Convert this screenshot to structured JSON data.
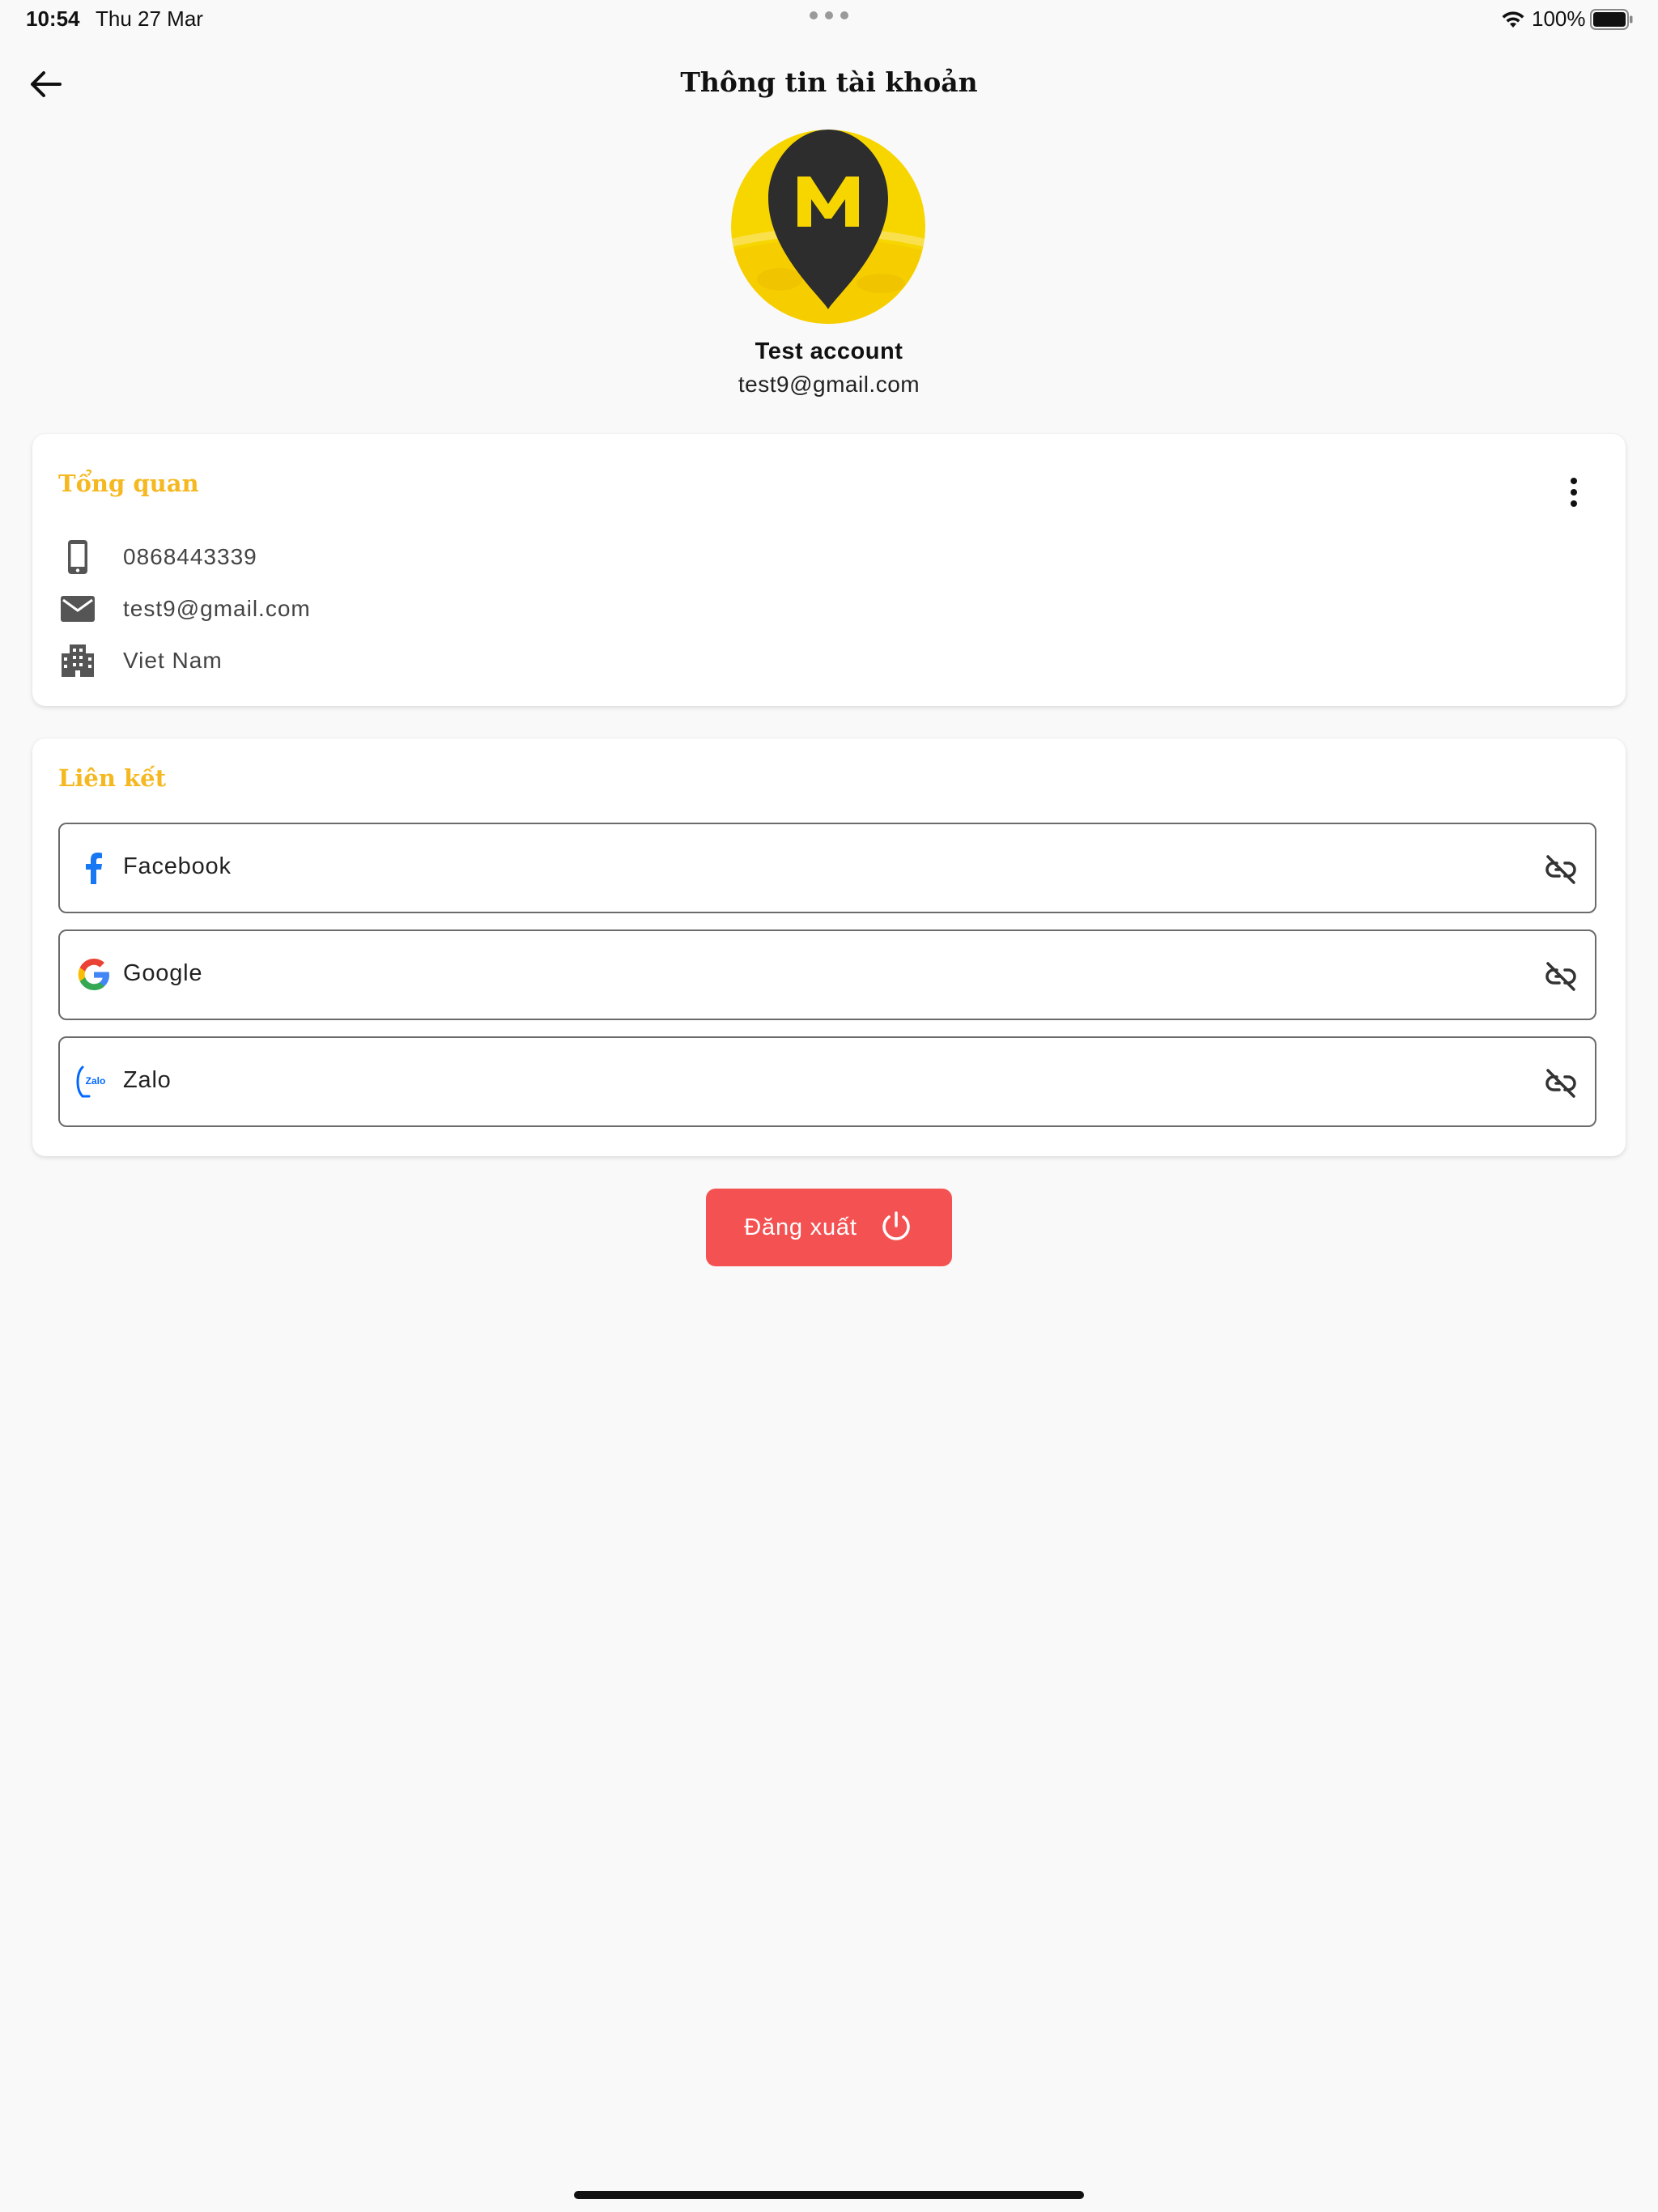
{
  "status_bar": {
    "time": "10:54",
    "date": "Thu 27 Mar",
    "battery": "100%"
  },
  "header": {
    "title": "Thông tin tài khoản",
    "back_icon": "arrow-left-icon"
  },
  "profile": {
    "avatar_letter": "M",
    "name": "Test account",
    "email": "test9@gmail.com"
  },
  "overview": {
    "title": "Tổng quan",
    "more_icon": "more-vertical-icon",
    "items": [
      {
        "icon": "phone-icon",
        "value": "0868443339"
      },
      {
        "icon": "mail-icon",
        "value": "test9@gmail.com"
      },
      {
        "icon": "building-icon",
        "value": "Viet Nam"
      }
    ]
  },
  "links": {
    "title": "Liên kết",
    "items": [
      {
        "icon": "facebook-icon",
        "label": "Facebook",
        "action_icon": "link-off-icon"
      },
      {
        "icon": "google-icon",
        "label": "Google",
        "action_icon": "link-off-icon"
      },
      {
        "icon": "zalo-icon",
        "label": "Zalo",
        "icon_text": "Zalo",
        "action_icon": "link-off-icon"
      }
    ]
  },
  "logout": {
    "label": "Đăng xuất",
    "icon": "power-icon"
  },
  "colors": {
    "accent": "#f5b820",
    "logout": "#f45252",
    "facebook": "#1877f2",
    "avatar_bg": "#f7d600"
  }
}
